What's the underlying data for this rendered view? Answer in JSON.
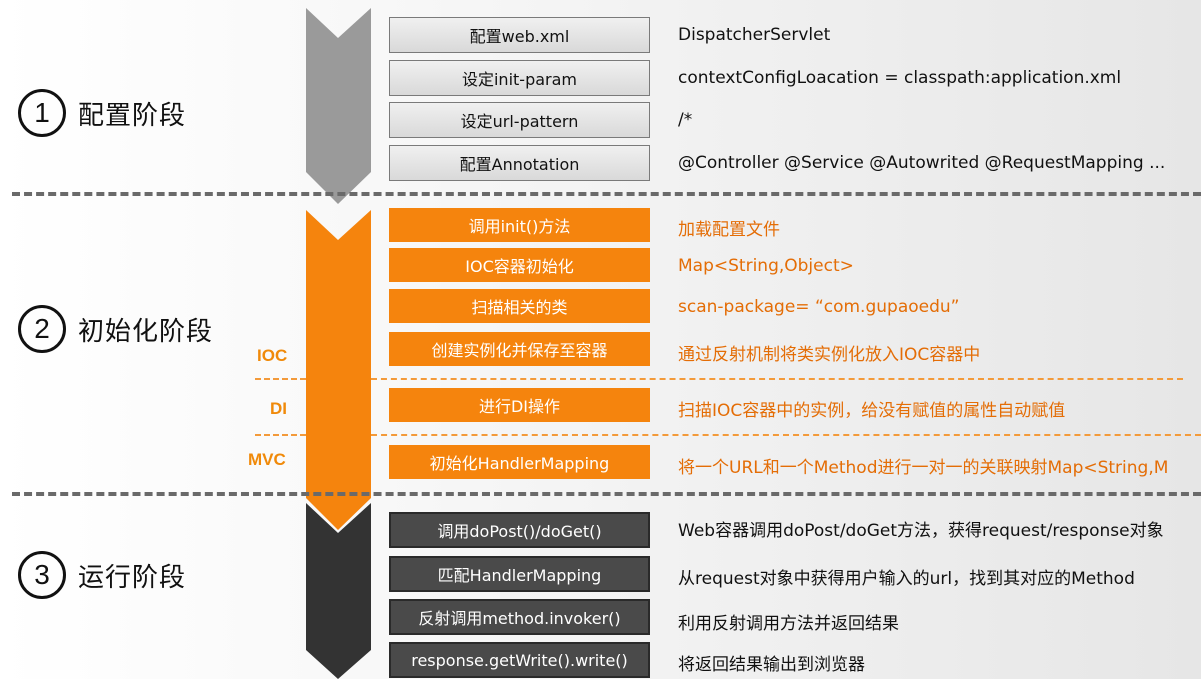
{
  "colors": {
    "orange": "#f5840d",
    "gray_arrow": "#9a9a9a",
    "dark_arrow": "#333333",
    "orange_text": "#e46d06"
  },
  "stages": [
    {
      "num": "1",
      "label": "配置阶段"
    },
    {
      "num": "2",
      "label": "初始化阶段"
    },
    {
      "num": "3",
      "label": "运行阶段"
    }
  ],
  "side_tags": {
    "ioc": "IOC",
    "di": "DI",
    "mvc": "MVC"
  },
  "config_steps": [
    {
      "box": "配置web.xml",
      "desc": "DispatcherServlet"
    },
    {
      "box": "设定init-param",
      "desc": "contextConfigLoacation = classpath:application.xml"
    },
    {
      "box": "设定url-pattern",
      "desc": "/*"
    },
    {
      "box": "配置Annotation",
      "desc": "@Controller  @Service  @Autowrited @RequestMapping ..."
    }
  ],
  "init_steps": [
    {
      "box": "调用init()方法",
      "desc": "加载配置文件"
    },
    {
      "box": "IOC容器初始化",
      "desc": "Map<String,Object>"
    },
    {
      "box": "扫描相关的类",
      "desc": "scan-package= “com.gupaoedu”"
    },
    {
      "box": "创建实例化并保存至容器",
      "desc": "通过反射机制将类实例化放入IOC容器中"
    },
    {
      "box": "进行DI操作",
      "desc": "扫描IOC容器中的实例，给没有赋值的属性自动赋值"
    },
    {
      "box": "初始化HandlerMapping",
      "desc": "将一个URL和一个Method进行一对一的关联映射Map<String,M"
    }
  ],
  "run_steps": [
    {
      "box": "调用doPost()/doGet()",
      "desc": "Web容器调用doPost/doGet方法，获得request/response对象"
    },
    {
      "box": "匹配HandlerMapping",
      "desc": "从request对象中获得用户输入的url，找到其对应的Method"
    },
    {
      "box": "反射调用method.invoker()",
      "desc": "利用反射调用方法并返回结果"
    },
    {
      "box": "response.getWrite().write()",
      "desc": "将返回结果输出到浏览器"
    }
  ]
}
